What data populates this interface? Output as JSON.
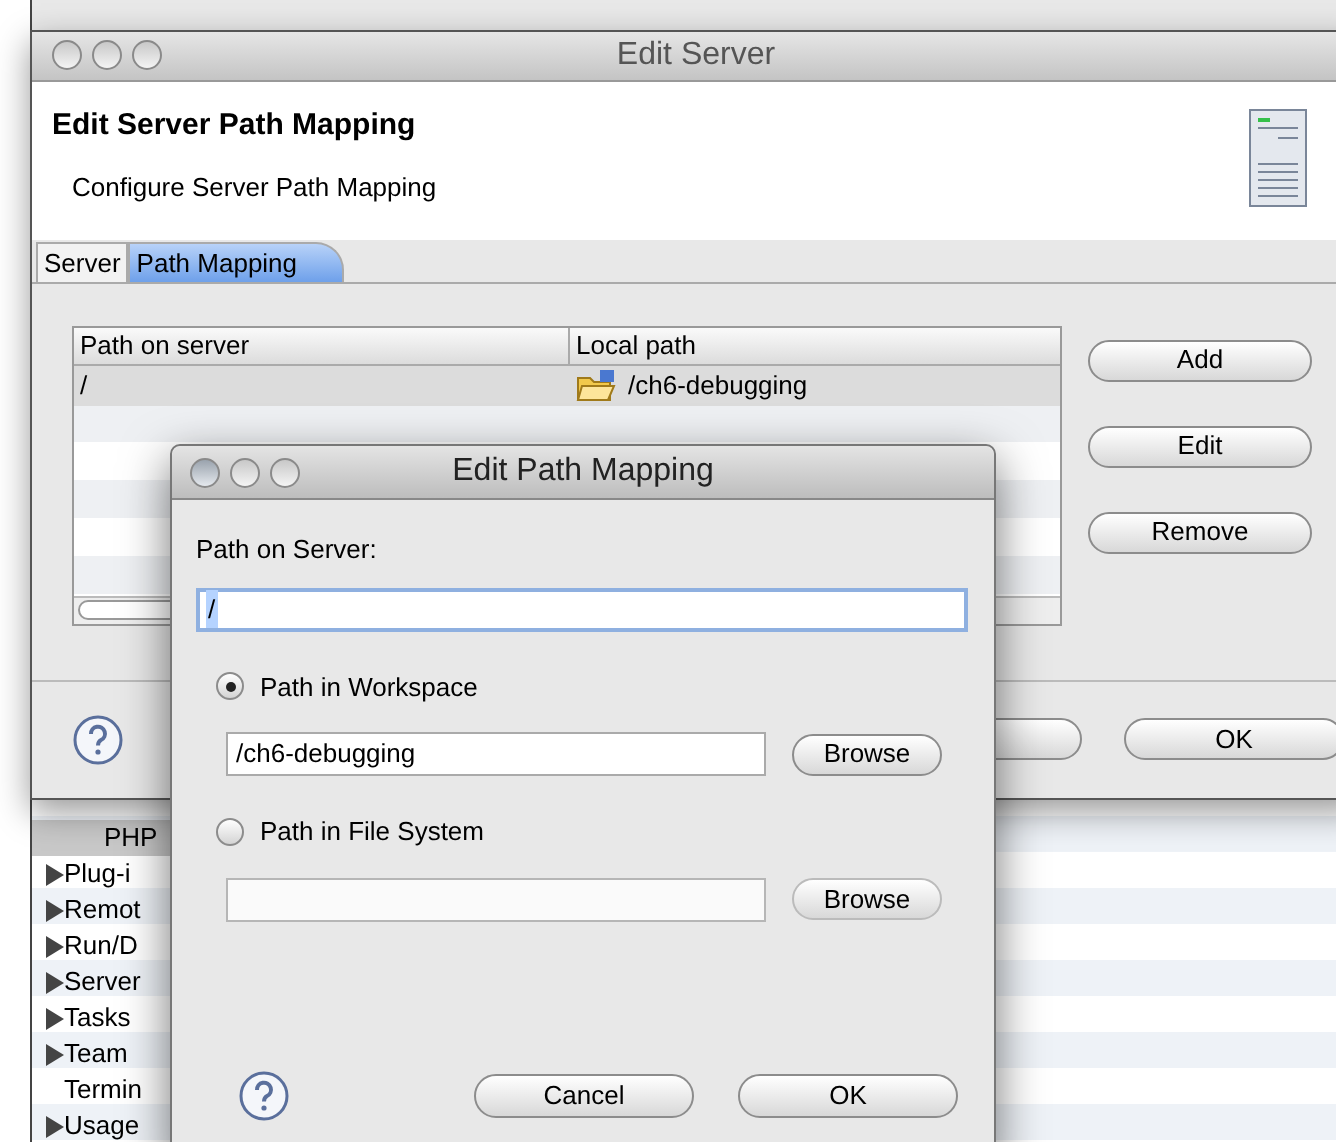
{
  "tree": [
    {
      "label": "PHP",
      "selected": true,
      "has_children": false,
      "indent": true
    },
    {
      "label": "Plug-i",
      "selected": false,
      "has_children": true
    },
    {
      "label": "Remot",
      "selected": false,
      "has_children": true
    },
    {
      "label": "Run/D",
      "selected": false,
      "has_children": true
    },
    {
      "label": "Server",
      "selected": false,
      "has_children": true
    },
    {
      "label": "Tasks",
      "selected": false,
      "has_children": true
    },
    {
      "label": "Team",
      "selected": false,
      "has_children": true
    },
    {
      "label": "Termin",
      "selected": false,
      "has_children": false
    },
    {
      "label": "Usage",
      "selected": false,
      "has_children": true
    }
  ],
  "edit_server": {
    "title": "Edit Server",
    "header_title": "Edit Server Path Mapping",
    "header_subtitle": "Configure Server Path Mapping",
    "tabs": [
      {
        "label": "Server",
        "selected": false
      },
      {
        "label": "Path Mapping",
        "selected": true
      }
    ],
    "table": {
      "columns": [
        "Path on server",
        "Local path"
      ],
      "rows": [
        {
          "path_on_server": "/",
          "local_path": "/ch6-debugging",
          "selected": true
        }
      ]
    },
    "side_buttons": [
      "Add",
      "Edit",
      "Remove"
    ],
    "ok_button": "OK"
  },
  "edit_path_mapping": {
    "title": "Edit Path Mapping",
    "path_label": "Path on Server:",
    "path_value": "/",
    "options": [
      {
        "label": "Path in Workspace",
        "selected": true,
        "value": "/ch6-debugging",
        "browse": "Browse"
      },
      {
        "label": "Path in File System",
        "selected": false,
        "browse": "Browse"
      }
    ],
    "cancel_button": "Cancel",
    "ok_button": "OK"
  }
}
